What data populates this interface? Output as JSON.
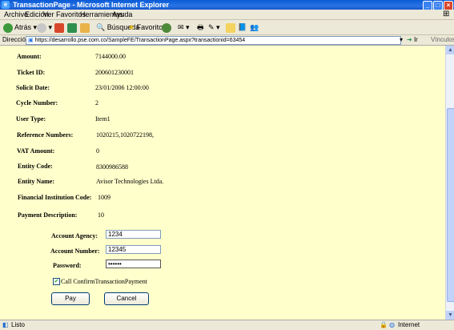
{
  "window": {
    "title": "TransactionPage - Microsoft Internet Explorer"
  },
  "menu": [
    "Archivo",
    "Edición",
    "Ver",
    "Favoritos",
    "Herramientas",
    "Ayuda"
  ],
  "toolbar": {
    "back": "Atrás",
    "search": "Búsqueda",
    "favorites": "Favoritos"
  },
  "address": {
    "label": "Dirección",
    "url": "https://desarrollo.pse.com.co/SampleFE/TransactionPage.aspx?transactionid=63454",
    "go": "Ir",
    "links": "Vínculos"
  },
  "details": [
    {
      "label": "Amount:",
      "value": "7144000.00"
    },
    {
      "label": "Ticket ID:",
      "value": "200601230001"
    },
    {
      "label": "Solicit Date:",
      "value": "23/01/2006 12:00:00"
    },
    {
      "label": "Cycle Number:",
      "value": "2"
    },
    {
      "label": "User Type:",
      "value": "Item1"
    },
    {
      "label": "Reference Numbers:",
      "value": "1020215,1020722198,"
    },
    {
      "label": "VAT Amount:",
      "value": "0"
    },
    {
      "label": "Entity Code:",
      "value": "8300986588"
    },
    {
      "label": "Entity Name:",
      "value": "Avisor Technologies Ltda."
    },
    {
      "label": "Financial Institution Code:",
      "value": "1009"
    },
    {
      "label": "Payment Description:",
      "value": "10"
    }
  ],
  "form": {
    "account_agency_label": "Account Agency:",
    "account_agency_value": "1234",
    "account_number_label": "Account Number:",
    "account_number_value": "12345",
    "password_label": "Password:",
    "password_value": "******",
    "confirm_label": "Call ConfirmTransactionPayment",
    "pay_label": "Pay",
    "cancel_label": "Cancel"
  },
  "status": {
    "left": "Listo",
    "zone": "Internet"
  }
}
